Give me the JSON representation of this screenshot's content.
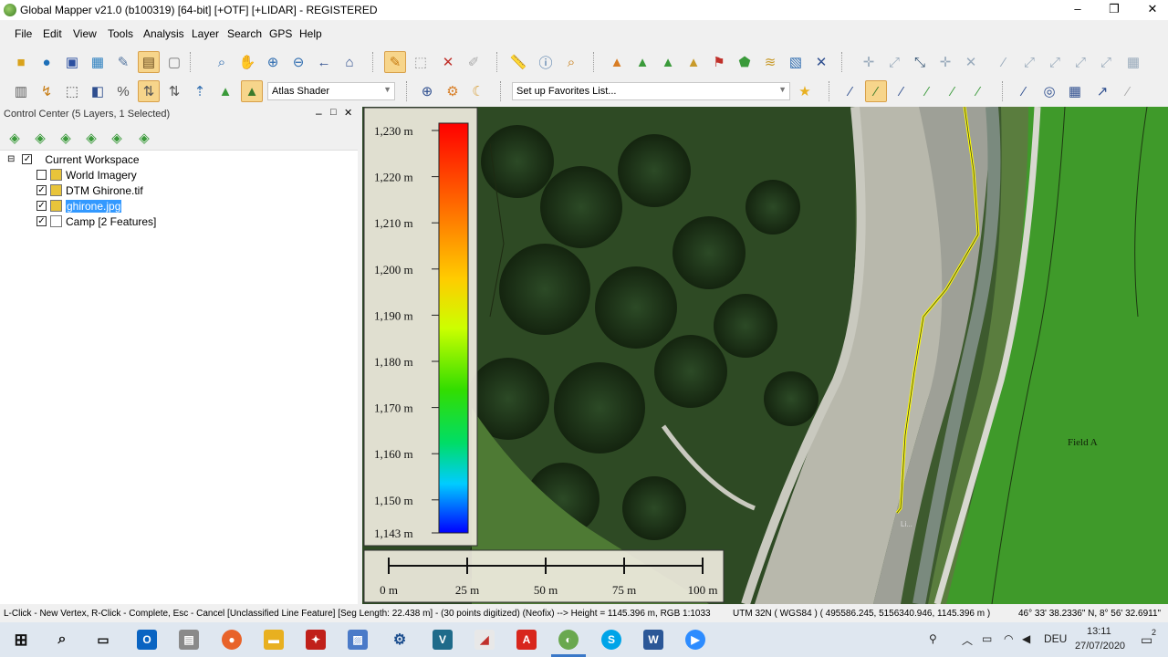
{
  "window": {
    "title": "Global Mapper v21.0 (b100319) [64-bit] [+OTF] [+LIDAR] - REGISTERED",
    "minimize": "–",
    "maximize": "❐",
    "close": "✕"
  },
  "menu": [
    "File",
    "Edit",
    "View",
    "Tools",
    "Analysis",
    "Layer",
    "Search",
    "GPS",
    "Help"
  ],
  "toolbar": {
    "shader_value": "Atlas Shader",
    "favorites_value": "Set up Favorites List..."
  },
  "control_center": {
    "title": "Control Center (5 Layers, 1 Selected)",
    "root": "Current Workspace",
    "layers": [
      {
        "name": "World Imagery",
        "checked": false,
        "selected": false
      },
      {
        "name": "DTM Ghirone.tif",
        "checked": true,
        "selected": false
      },
      {
        "name": "ghirone.jpg",
        "checked": true,
        "selected": true
      },
      {
        "name": "Camp [2 Features]",
        "checked": true,
        "selected": false
      }
    ]
  },
  "elevation_legend": {
    "labels": [
      "1,230 m",
      "1,220 m",
      "1,210 m",
      "1,200 m",
      "1,190 m",
      "1,180 m",
      "1,170 m",
      "1,160 m",
      "1,150 m",
      "1,143 m"
    ]
  },
  "scale_bar": {
    "labels": [
      "0 m",
      "25 m",
      "50 m",
      "75 m",
      "100 m"
    ]
  },
  "map": {
    "field_label": "Field A"
  },
  "status": {
    "hint": "L-Click - New Vertex, R-Click - Complete, Esc - Cancel [Unclassified Line Feature] [Seg Length: 22.438 m] - (30 points digitized) (Neofix) --> Height = 1145.396 m, RGB 1:1033",
    "coords": "UTM 32N ( WGS84 ) ( 495586.245, 5156340.946, 1145.396 m )",
    "latlon": "46° 33' 38.2336\" N, 8° 56' 32.6911\""
  },
  "taskbar": {
    "lang": "DEU",
    "time": "13:11",
    "date": "27/07/2020",
    "notif": "2"
  },
  "colors": {
    "accent_selected": "#3399ff",
    "track": "#ffff00",
    "grass": "#3f9a2a"
  }
}
